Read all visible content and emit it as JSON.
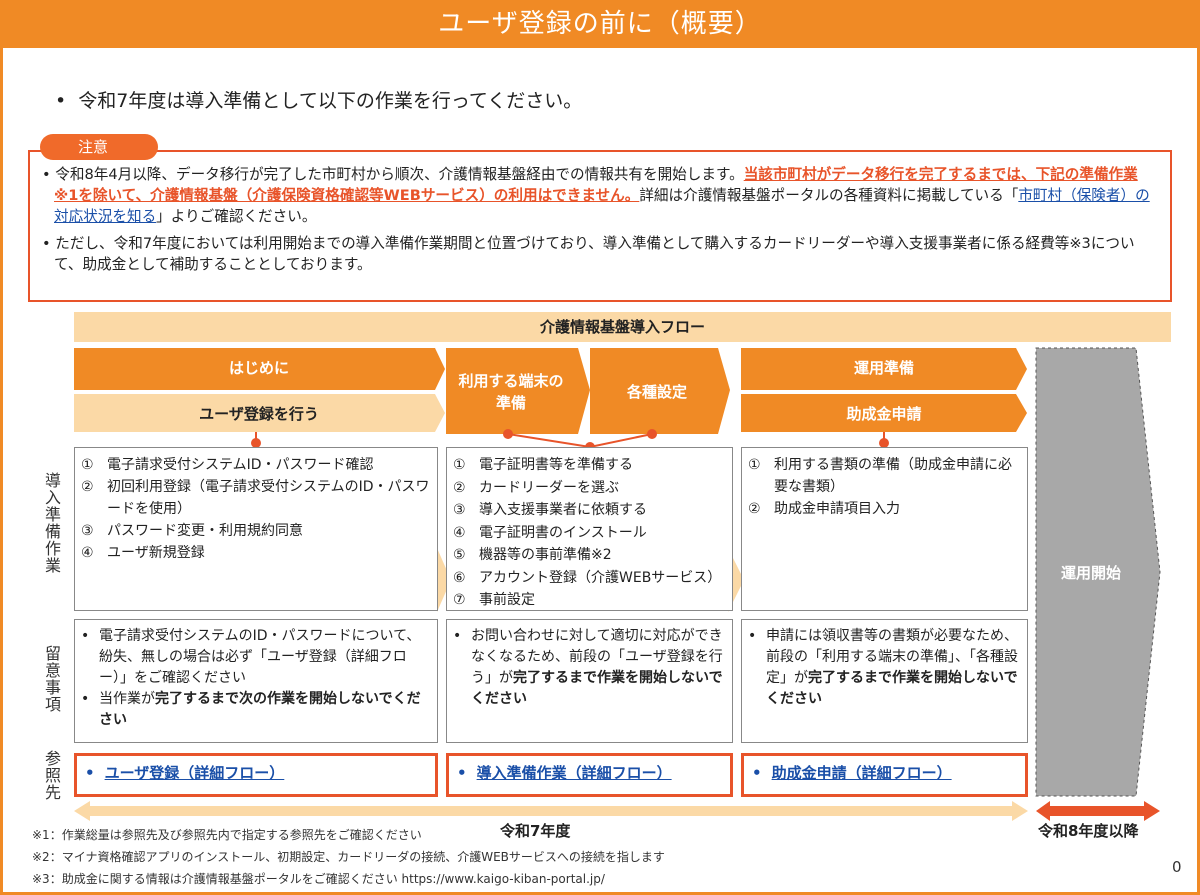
{
  "title": "ユーザ登録の前に（概要）",
  "lead": "令和7年度は導入準備として以下の作業を行ってください。",
  "notice_tag": "注意",
  "notice": {
    "p1_a": "令和8年4月以降、データ移行が完了した市町村から順次、介護情報基盤経由での情報共有を開始します。",
    "p1_hl": "当該市町村がデータ移行を完了するまでは、下記の準備作業※1を除いて、介護情報基盤（介護保険資格確認等WEBサービス）の利用はできません。",
    "p1_b": "詳細は介護情報基盤ポータルの各種資料に掲載している「",
    "p1_link": "市町村（保険者）の対応状況を知る",
    "p1_c": "」よりご確認ください。",
    "p2": "ただし、令和7年度においては利用開始までの導入準備作業期間と位置づけており、導入準備として購入するカードリーダーや導入支援事業者に係る経費等※3について、助成金として補助することとしております。"
  },
  "flow_title": "介護情報基盤導入フロー",
  "stages": {
    "s1": "はじめに",
    "s1b": "ユーザ登録を行う",
    "s2": "利用する端末の準備",
    "s3": "各種設定",
    "s4": "運用準備",
    "s4b": "助成金申請",
    "s5": "運用開始"
  },
  "side": {
    "prep": "導入準備作業",
    "notes": "留意事項",
    "ref": "参照先"
  },
  "prep1": [
    {
      "n": "①",
      "t": "電子請求受付システムID・パスワード確認"
    },
    {
      "n": "②",
      "t": "初回利用登録（電子請求受付システムのID・パスワードを使用）"
    },
    {
      "n": "③",
      "t": "パスワード変更・利用規約同意"
    },
    {
      "n": "④",
      "t": "ユーザ新規登録"
    }
  ],
  "prep2": [
    {
      "n": "①",
      "t": "電子証明書等を準備する"
    },
    {
      "n": "②",
      "t": "カードリーダーを選ぶ"
    },
    {
      "n": "③",
      "t": "導入支援事業者に依頼する"
    },
    {
      "n": "④",
      "t": "電子証明書のインストール"
    },
    {
      "n": "⑤",
      "t": "機器等の事前準備※2"
    },
    {
      "n": "⑥",
      "t": "アカウント登録（介護WEBサービス）"
    },
    {
      "n": "⑦",
      "t": "事前設定"
    }
  ],
  "prep3": [
    {
      "n": "①",
      "t": "利用する書類の準備（助成金申請に必要な書類）"
    },
    {
      "n": "②",
      "t": "助成金申請項目入力"
    }
  ],
  "notes1": {
    "a": "電子請求受付システムのID・パスワードについて、紛失、無しの場合は必ず「ユーザ登録（詳細フロー）」をご確認ください",
    "b1": "当作業が",
    "b2": "完了するまで次の作業を開始しないでください"
  },
  "notes2": {
    "a": "お問い合わせに対して適切に対応ができなくなるため、前段の「ユーザ登録を行う」が",
    "b": "完了するまで作業を開始しないでください"
  },
  "notes3": {
    "a": "申請には領収書等の書類が必要なため、前段の「利用する端末の準備」、「各種設定」が",
    "b": "完了するまで作業を開始しないでください"
  },
  "refs": [
    "ユーザ登録（詳細フロー）",
    "導入準備作業（詳細フロー）",
    "助成金申請（詳細フロー）"
  ],
  "ref_bullet": "•",
  "year7": "令和7年度",
  "year8": "令和8年度以降",
  "footnotes": [
    "※1：作業総量は参照先及び参照先内で指定する参照先をご確認ください",
    "※2：マイナ資格確認アプリのインストール、初期設定、カードリーダの接続、介護WEBサービスへの接続を指します",
    "※3：助成金に関する情報は介護情報基盤ポータルをご確認ください https://www.kaigo-kiban-portal.jp/"
  ],
  "page_number": "0",
  "colors": {
    "orange": "#f08a25",
    "red": "#e8542a",
    "light": "#fbd9a6",
    "gray": "#a8a8a8",
    "link": "#1a4fa8"
  }
}
